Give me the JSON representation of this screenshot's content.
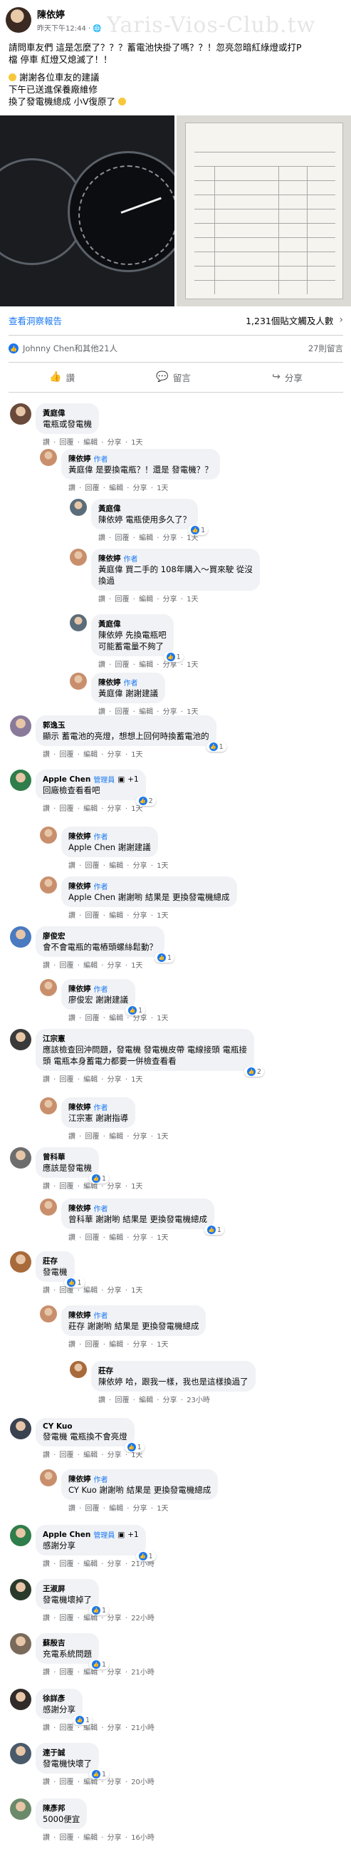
{
  "watermark": "Yaris-Vios-Club.tw",
  "post": {
    "author": "陳依婷",
    "time": "昨天下午12:44 · ",
    "lines": [
      "請問車友們 這是怎麼了？？？蓄電池快掛了嗎？？！忽亮忽暗紅綠燈或打P",
      "檔 停車 紅燈又熄滅了！！",
      "",
      "謝謝各位車友的建議",
      "下午已送進保養廠維修",
      "換了發電機總成  小V復原了"
    ]
  },
  "info": {
    "link": "查看洞察報告",
    "right": "1,231個貼文觸及人數"
  },
  "reactions": {
    "names": "Johnny Chen和其他21人",
    "comments": "27則留言"
  },
  "actions": {
    "like": "讚",
    "comment": "留言",
    "share": "分享"
  },
  "colors": {
    "link": "#1877f2",
    "bubble": "#f0f2f5",
    "meta": "#65676b"
  },
  "comments": [
    {
      "name": "黃庭偉",
      "text": [
        "電瓶或發電機"
      ],
      "meta": [
        "讚",
        "回覆",
        "編輯",
        "分享",
        "1天"
      ]
    },
    {
      "name": "陳依婷",
      "tag": "作者",
      "text": [
        "黃庭偉 是要換電瓶？！還是 發電機？？"
      ],
      "meta": [
        "讚",
        "回覆",
        "編輯",
        "分享",
        "1天"
      ]
    },
    {
      "name": "黃庭偉",
      "text": [
        "陳依婷 電瓶使用多久了？"
      ],
      "badge": "1",
      "meta": [
        "讚",
        "回覆",
        "編輯",
        "分享",
        "1天"
      ]
    },
    {
      "name": "陳依婷",
      "tag": "作者",
      "text": [
        "黃庭偉  買二手的 108年購入～買來駛 從沒",
        "換過"
      ],
      "meta": [
        "讚",
        "回覆",
        "編輯",
        "分享",
        "1天"
      ]
    },
    {
      "name": "黃庭偉",
      "text": [
        "陳依婷 先換電瓶吧",
        "可能蓄電量不夠了"
      ],
      "badge": "1",
      "meta": [
        "讚",
        "回覆",
        "編輯",
        "分享",
        "1天"
      ]
    },
    {
      "name": "陳依婷",
      "tag": "作者",
      "text": [
        "黃庭偉 謝謝建議"
      ],
      "meta": [
        "讚",
        "回覆",
        "編輯",
        "分享",
        "1天"
      ]
    },
    {
      "name": "郭逸玉",
      "text": [
        "顯示 蓄電池的亮燈，想想上回何時換蓄電池的"
      ],
      "badge": "1",
      "meta": [
        "讚",
        "回覆",
        "編輯",
        "分享",
        "1天"
      ]
    },
    {
      "name": "Apple Chen",
      "admin": "管理員",
      "plus": "+1",
      "text": [
        "回廠檢查看看吧"
      ],
      "badge": "2",
      "meta": [
        "讚",
        "回覆",
        "編輯",
        "分享",
        "1天"
      ]
    },
    {
      "name": "陳依婷",
      "tag": "作者",
      "text": [
        "Apple Chen 謝謝建議"
      ],
      "meta": [
        "讚",
        "回覆",
        "編輯",
        "分享",
        "1天"
      ]
    },
    {
      "name": "陳依婷",
      "tag": "作者",
      "text": [
        "Apple Chen 謝謝喲 結果是 更換發電機總成"
      ],
      "meta": [
        "讚",
        "回覆",
        "編輯",
        "分享",
        "1天"
      ]
    },
    {
      "name": "廖俊宏",
      "text": [
        "會不會電瓶的電樁頭螺絲鬆動？"
      ],
      "badge": "1",
      "meta": [
        "讚",
        "回覆",
        "編輯",
        "分享",
        "1天"
      ]
    },
    {
      "name": "陳依婷",
      "tag": "作者",
      "text": [
        "廖俊宏 謝謝建議"
      ],
      "badge": "1",
      "meta": [
        "讚",
        "回覆",
        "編輯",
        "分享",
        "1天"
      ]
    },
    {
      "name": "江宗憲",
      "text": [
        "應該檢查回沖問題，發電機 發電機皮帶 電線接頭 電瓶接",
        "頭 電瓶本身蓄電力都要一併檢查看看"
      ],
      "badge": "2",
      "meta": [
        "讚",
        "回覆",
        "編輯",
        "分享",
        "1天"
      ]
    },
    {
      "name": "陳依婷",
      "tag": "作者",
      "text": [
        "江宗憲 謝謝指導"
      ],
      "meta": [
        "讚",
        "回覆",
        "編輯",
        "分享",
        "1天"
      ]
    },
    {
      "name": "曾科華",
      "text": [
        "應該是發電機"
      ],
      "badge": "1",
      "meta": [
        "讚",
        "回覆",
        "編輯",
        "分享",
        "1天"
      ]
    },
    {
      "name": "陳依婷",
      "tag": "作者",
      "text": [
        "曾科華 謝謝喲 結果是 更換發電機總成"
      ],
      "badge": "1",
      "meta": [
        "讚",
        "回覆",
        "編輯",
        "分享",
        "1天"
      ]
    },
    {
      "name": "莊存",
      "text": [
        "發電機"
      ],
      "badge": "1",
      "meta": [
        "讚",
        "回覆",
        "編輯",
        "分享",
        "1天"
      ]
    },
    {
      "name": "陳依婷",
      "tag": "作者",
      "text": [
        "莊存 謝謝喲 結果是 更換發電機總成"
      ],
      "meta": [
        "讚",
        "回覆",
        "編輯",
        "分享",
        "1天"
      ]
    },
    {
      "name": "莊存",
      "text": [
        "陳依婷 哈，跟我一樣，我也是這樣換過了"
      ],
      "meta": [
        "讚",
        "回覆",
        "編輯",
        "分享",
        "23小時"
      ]
    },
    {
      "name": "CY Kuo",
      "text": [
        "發電機 電瓶換不會亮燈"
      ],
      "badge": "1",
      "meta": [
        "讚",
        "回覆",
        "編輯",
        "分享",
        "1天"
      ]
    },
    {
      "name": "陳依婷",
      "tag": "作者",
      "text": [
        "CY Kuo 謝謝喲 結果是 更換發電機總成"
      ],
      "meta": [
        "讚",
        "回覆",
        "編輯",
        "分享",
        "1天"
      ]
    },
    {
      "name": "Apple Chen",
      "admin": "管理員",
      "plus": "+1",
      "text": [
        "感謝分享"
      ],
      "badge": "1",
      "meta": [
        "讚",
        "回覆",
        "編輯",
        "分享",
        "21小時"
      ]
    },
    {
      "name": "王淑屏",
      "text": [
        "發電機壞掉了"
      ],
      "badge": "1",
      "meta": [
        "讚",
        "回覆",
        "編輯",
        "分享",
        "22小時"
      ]
    },
    {
      "name": "蘇殷吉",
      "text": [
        "充電系統問題"
      ],
      "badge": "1",
      "meta": [
        "讚",
        "回覆",
        "編輯",
        "分享",
        "21小時"
      ]
    },
    {
      "name": "徐詳彥",
      "text": [
        "感謝分享"
      ],
      "badge": "1",
      "meta": [
        "讚",
        "回覆",
        "編輯",
        "分享",
        "21小時"
      ]
    },
    {
      "name": "連于誠",
      "text": [
        "發電機快壞了"
      ],
      "badge": "1",
      "meta": [
        "讚",
        "回覆",
        "編輯",
        "分享",
        "20小時"
      ]
    },
    {
      "name": "陳彥邦",
      "text": [
        "5000便宜"
      ],
      "meta": [
        "讚",
        "回覆",
        "編輯",
        "分享",
        "16小時"
      ]
    }
  ]
}
